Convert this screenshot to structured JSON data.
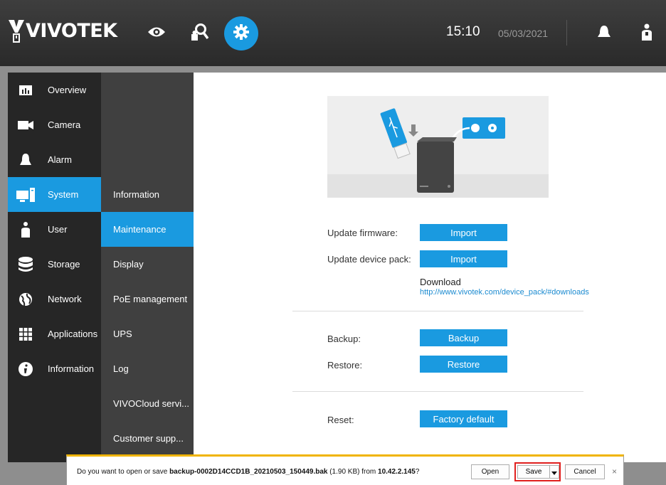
{
  "header": {
    "brand": "VIVOTEK",
    "time": "15:10",
    "date": "05/03/2021",
    "icons": [
      "eye-icon",
      "search-user-icon",
      "gear-icon",
      "bell-icon",
      "person-icon"
    ]
  },
  "sidebar": {
    "items": [
      {
        "label": "Overview",
        "icon": "chart-icon"
      },
      {
        "label": "Camera",
        "icon": "video-camera-icon"
      },
      {
        "label": "Alarm",
        "icon": "bell-icon"
      },
      {
        "label": "System",
        "icon": "monitor-icon",
        "active": true
      },
      {
        "label": "User",
        "icon": "user-icon"
      },
      {
        "label": "Storage",
        "icon": "database-icon"
      },
      {
        "label": "Network",
        "icon": "globe-icon"
      },
      {
        "label": "Applications",
        "icon": "grid-icon"
      },
      {
        "label": "Information",
        "icon": "info-icon"
      }
    ]
  },
  "submenu": {
    "items": [
      {
        "label": "Information"
      },
      {
        "label": "Maintenance",
        "active": true
      },
      {
        "label": "Display"
      },
      {
        "label": "PoE management"
      },
      {
        "label": "UPS"
      },
      {
        "label": "Log"
      },
      {
        "label": "VIVOCloud servi..."
      },
      {
        "label": "Customer supp..."
      }
    ]
  },
  "main": {
    "update_firmware_label": "Update firmware:",
    "update_firmware_button": "Import",
    "update_pack_label": "Update device pack:",
    "update_pack_button": "Import",
    "download_label": "Download",
    "download_link": "http://www.vivotek.com/device_pack/#downloads",
    "backup_label": "Backup:",
    "backup_button": "Backup",
    "restore_label": "Restore:",
    "restore_button": "Restore",
    "reset_label": "Reset:",
    "reset_button": "Factory default"
  },
  "notification": {
    "prefix": "Do you want to open or save ",
    "filename": "backup-0002D14CCD1B_20210503_150449.bak",
    "size": " (1.90 KB) from ",
    "host": "10.42.2.145",
    "suffix": "?",
    "open_label": "Open",
    "save_label": "Save",
    "cancel_label": "Cancel",
    "close_label": "×"
  },
  "colors": {
    "accent": "#1a9ae0",
    "sidebar": "#262626",
    "submenu": "#404040",
    "highlight": "#e0201e"
  }
}
